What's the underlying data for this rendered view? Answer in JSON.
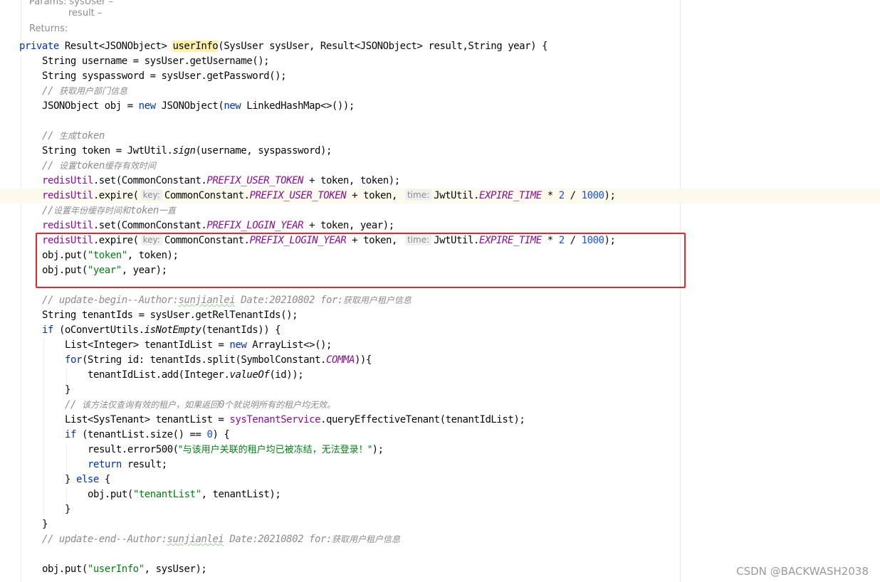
{
  "doc": {
    "params_label": "Params:",
    "param1": "sysUser –",
    "param2": "result –",
    "returns_label": "Returns:"
  },
  "code": {
    "l0": {
      "kw": "private",
      "t1": " Result<JSONObject> ",
      "m": "userInfo",
      "t2": "(SysUser sysUser, Result<JSONObject> result,String year) {"
    },
    "l1": "String username = sysUser.getUsername();",
    "l2": "String syspassword = sysUser.getPassword();",
    "l3": {
      "slash": "// ",
      "zh": "获取用户部门信息"
    },
    "l4": {
      "t1": "JSONObject obj = ",
      "kw1": "new",
      "t2": " JSONObject(",
      "kw2": "new",
      "t3": " LinkedHashMap<>());"
    },
    "l6": {
      "slash": "// ",
      "zh1": "生成",
      "w": "token"
    },
    "l7": {
      "t1": "String token = JwtUtil.",
      "s": "sign",
      "t2": "(username, syspassword);"
    },
    "l8": {
      "slash": "// ",
      "zh1": "设置",
      "w": "token",
      "zh2": "缓存有效时间"
    },
    "l9": {
      "f": "redisUtil",
      "t1": ".set(CommonConstant.",
      "c": "PREFIX_USER_TOKEN",
      "t2": " + token, token);"
    },
    "l10": {
      "f": "redisUtil",
      "t1": ".expire(",
      "h1": "key:",
      "t2": "CommonConstant.",
      "c1": "PREFIX_USER_TOKEN",
      "t3": " + token, ",
      "h2": "time:",
      "t4": "JwtUtil.",
      "c2": "EXPIRE_TIME",
      "t5": " * ",
      "n1": "2",
      "t6": " / ",
      "n2": "1000",
      "t7": ");"
    },
    "l11": {
      "slash": "//",
      "zh1": "设置年份缓存时间和",
      "w": "token",
      "zh2": "一直"
    },
    "l12": {
      "f": "redisUtil",
      "t1": ".set(CommonConstant.",
      "c": "PREFIX_LOGIN_YEAR",
      "t2": " + token, year);"
    },
    "l13": {
      "f": "redisUtil",
      "t1": ".expire(",
      "h1": "key:",
      "t2": "CommonConstant.",
      "c1": "PREFIX_LOGIN_YEAR",
      "t3": " + token, ",
      "h2": "time:",
      "t4": "JwtUtil.",
      "c2": "EXPIRE_TIME",
      "t5": " * ",
      "n1": "2",
      "t6": " / ",
      "n2": "1000",
      "t7": ");"
    },
    "l14": {
      "t1": "obj.put(",
      "s": "\"token\"",
      "t2": ", token);"
    },
    "l15": {
      "t1": "obj.put(",
      "s": "\"year\"",
      "t2": ", year);"
    },
    "l17": {
      "a": "// update-begin--Author:",
      "u": "sunjianlei",
      "b": " Date:20210802 for:",
      "zh": "获取用户租户信息"
    },
    "l18": "String tenantIds = sysUser.getRelTenantIds();",
    "l19": {
      "kw": "if",
      "t1": " (oConvertUtils.",
      "s": "isNotEmpty",
      "t2": "(tenantIds)) {"
    },
    "l20": {
      "t1": "List<Integer> tenantIdList = ",
      "kw": "new",
      "t2": " ArrayList<>();"
    },
    "l21": {
      "kw": "for",
      "t1": "(String id: tenantIds.split(SymbolConstant.",
      "c": "COMMA",
      "t2": ")){"
    },
    "l22": {
      "t1": "tenantIdList.add(Integer.",
      "s": "valueOf",
      "t2": "(id));"
    },
    "l23": "}",
    "l24": {
      "slash": "// ",
      "zh1": "该方法仅查询有效的租户，如果返回",
      "n": "0",
      "zh2": "个就说明所有的租户均无效。"
    },
    "l25": {
      "t1": "List<SysTenant> tenantList = ",
      "f": "sysTenantService",
      "t2": ".queryEffectiveTenant(tenantIdList);"
    },
    "l26": {
      "kw": "if",
      "t1": " (tenantList.size() == ",
      "n": "0",
      "t2": ") {"
    },
    "l27": {
      "t1": "result.error500(",
      "s": "\"与该用户关联的租户均已被冻结，无法登录！\"",
      "t2": ");"
    },
    "l28": {
      "kw": "return",
      "t1": " result;"
    },
    "l29": {
      "t1": "} ",
      "kw": "else",
      "t2": " {"
    },
    "l30": {
      "t1": "obj.put(",
      "s": "\"tenantList\"",
      "t2": ", tenantList);"
    },
    "l31": "}",
    "l32": "}",
    "l33": {
      "a": "// update-end--Author:",
      "u": "sunjianlei",
      "b": " Date:20210802 for:",
      "zh": "获取用户租户信息"
    },
    "l35": {
      "t1": "obj.put(",
      "s": "\"userInfo\"",
      "t2": ", sysUser);"
    }
  },
  "watermark": "CSDN @BACKWASH2038",
  "colors": {
    "keyword": "#0033b3",
    "field": "#871094",
    "string": "#067d17",
    "number": "#1750eb",
    "comment": "#8c8c8c",
    "highlight_box": "#e5262e",
    "method_decl_bg": "#fcf1a4"
  }
}
